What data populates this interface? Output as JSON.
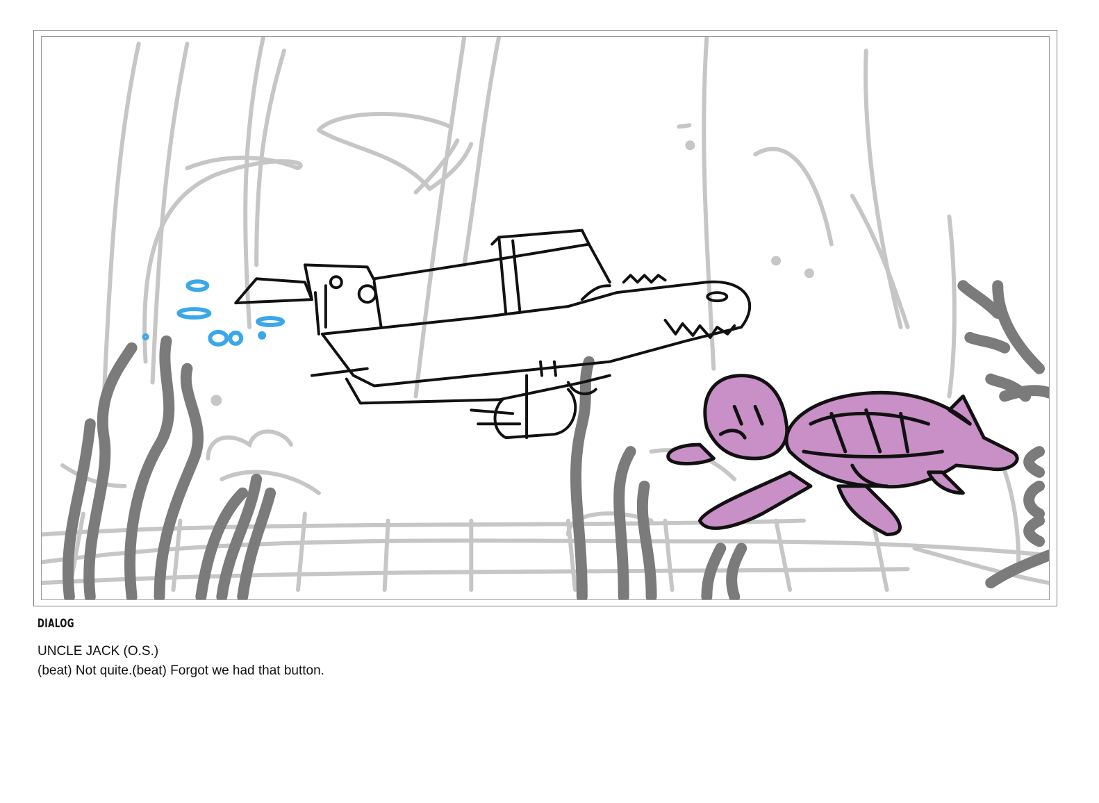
{
  "dialog": {
    "heading": "DIALOG",
    "speaker": "UNCLE JACK (O.S.)",
    "line": "(beat) Not quite.(beat) Forgot we had that button."
  },
  "colors": {
    "background_sketch": "#c6c6c6",
    "seaweed": "#7b7b7b",
    "ink": "#111111",
    "bubbles": "#3ba7ea",
    "turtle_fill": "#c98fc7"
  },
  "icons": [
    "bubbles-icon"
  ]
}
